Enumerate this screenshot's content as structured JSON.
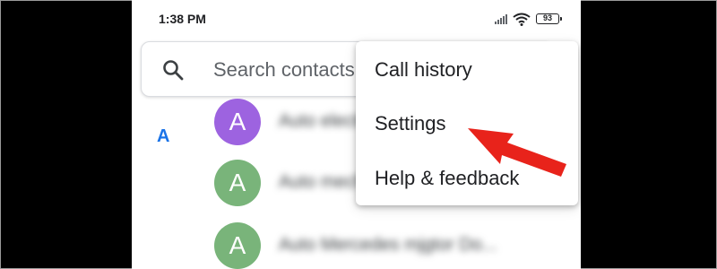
{
  "status_bar": {
    "time": "1:38 PM",
    "battery": "93",
    "icons": [
      "signal-icon",
      "wifi-icon",
      "battery-icon"
    ]
  },
  "search": {
    "placeholder": "Search contacts",
    "icon": "search-icon"
  },
  "contacts": {
    "section_letter": "A",
    "items": [
      {
        "avatar_letter": "A",
        "name": "Auto electrician",
        "avatar_color": "#9d63e0"
      },
      {
        "avatar_letter": "A",
        "name": "Auto mechanic",
        "avatar_color": "#79b47a"
      },
      {
        "avatar_letter": "A",
        "name": "Auto Mercedes mjgtor Do...",
        "avatar_color": "#79b47a"
      }
    ]
  },
  "menu": {
    "items": [
      {
        "label": "Call history"
      },
      {
        "label": "Settings"
      },
      {
        "label": "Help & feedback"
      }
    ]
  },
  "annotation": {
    "arrow_color": "#e8231b",
    "points_to": "Settings"
  },
  "colors": {
    "accent": "#1a73e8",
    "background": "#000000",
    "surface": "#ffffff"
  }
}
